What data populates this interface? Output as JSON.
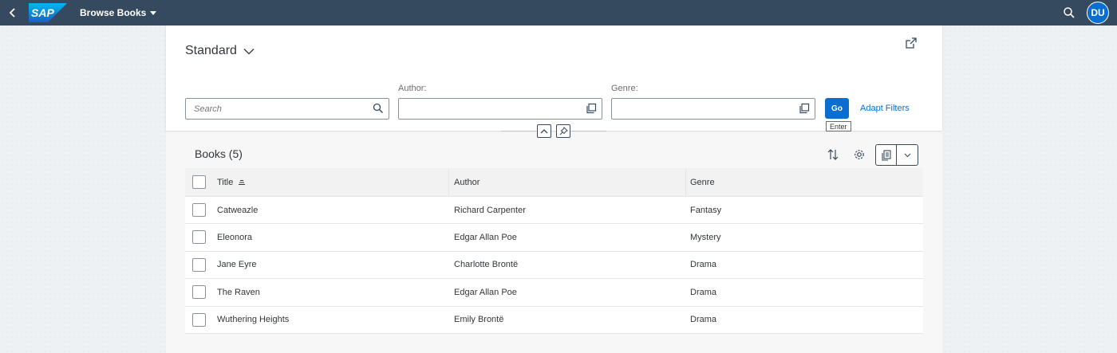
{
  "shell": {
    "logo_text": "SAP",
    "app_title": "Browse Books",
    "avatar_initials": "DU"
  },
  "header": {
    "variant_name": "Standard",
    "search_placeholder": "Search",
    "author_label": "Author:",
    "genre_label": "Genre:",
    "go_label": "Go",
    "go_tooltip": "Enter",
    "adapt_filters_label": "Adapt Filters"
  },
  "table": {
    "title": "Books (5)",
    "columns": [
      "Title",
      "Author",
      "Genre"
    ],
    "rows": [
      {
        "title": "Catweazle",
        "author": "Richard Carpenter",
        "genre": "Fantasy"
      },
      {
        "title": "Eleonora",
        "author": "Edgar Allan Poe",
        "genre": "Mystery"
      },
      {
        "title": "Jane Eyre",
        "author": "Charlotte Brontë",
        "genre": "Drama"
      },
      {
        "title": "The Raven",
        "author": "Edgar Allan Poe",
        "genre": "Drama"
      },
      {
        "title": "Wuthering Heights",
        "author": "Emily Brontë",
        "genre": "Drama"
      }
    ]
  },
  "colors": {
    "shell_bg": "#354a5f",
    "accent": "#0a6ed1",
    "text": "#32363a"
  },
  "icons": {
    "back": "chevron-left-icon",
    "search": "search-icon",
    "share": "share-icon",
    "value_help": "value-help-icon",
    "collapse": "chevron-up-icon",
    "pin": "pin-icon",
    "sort": "sort-icon",
    "settings": "gear-icon",
    "export": "export-icon",
    "dropdown": "chevron-down-icon",
    "sort_ascending": "sort-ascending-icon"
  }
}
